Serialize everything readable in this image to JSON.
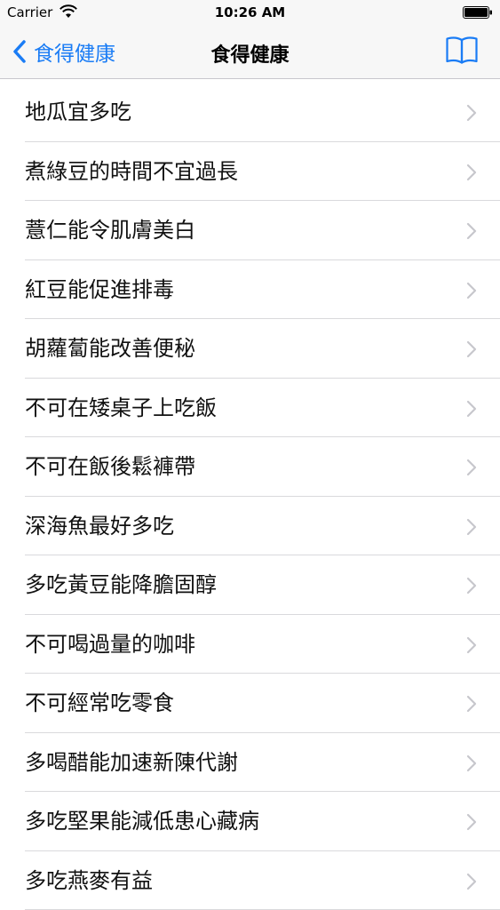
{
  "status_bar": {
    "carrier": "Carrier",
    "time": "10:26 AM"
  },
  "nav": {
    "back_label": "食得健康",
    "title": "食得健康",
    "accent_color": "#1a7cf5"
  },
  "list": {
    "items": [
      "地瓜宜多吃",
      "煮綠豆的時間不宜過長",
      "薏仁能令肌膚美白",
      "紅豆能促進排毒",
      "胡蘿蔔能改善便秘",
      "不可在矮桌子上吃飯",
      "不可在飯後鬆褲帶",
      "深海魚最好多吃",
      "多吃黃豆能降膽固醇",
      "不可喝過量的咖啡",
      "不可經常吃零食",
      "多喝醋能加速新陳代謝",
      "多吃堅果能減低患心藏病",
      "多吃燕麥有益"
    ]
  }
}
